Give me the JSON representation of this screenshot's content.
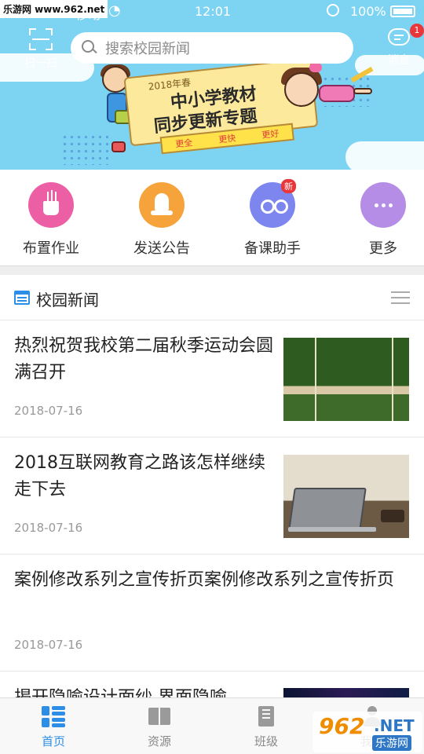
{
  "watermark": "乐游网 www.962.net",
  "status_bar": {
    "carrier": "移动",
    "time": "12:01",
    "battery": "100%"
  },
  "header": {
    "scan_label": "扫一扫",
    "search_placeholder": "搜索校园新闻",
    "messages_label": "消息",
    "messages_badge": "1"
  },
  "banner": {
    "year_tag": "2018年春",
    "title_line1": "中小学教材",
    "title_line2": "同步更新专题",
    "tags": [
      "更全",
      "更快",
      "更好"
    ]
  },
  "quick_actions": [
    {
      "label": "布置作业",
      "color": "#ec5fa4",
      "icon": "pencil-cup-icon"
    },
    {
      "label": "发送公告",
      "color": "#f7a33c",
      "icon": "bell-icon"
    },
    {
      "label": "备课助手",
      "color": "#7c86ee",
      "icon": "owl-icon",
      "badge": "新"
    },
    {
      "label": "更多",
      "color": "#b58de6",
      "icon": "more-dots-icon"
    }
  ],
  "news_section": {
    "title": "校园新闻"
  },
  "news": [
    {
      "title": "热烈祝贺我校第二届秋季运动会圆满召开",
      "date": "2018-07-16"
    },
    {
      "title": "2018互联网教育之路该怎样继续走下去",
      "date": "2018-07-16"
    },
    {
      "title": "案例修改系列之宣传折页案例修改系列之宣传折页",
      "date": "2018-07-16"
    },
    {
      "title": "揭开隐喻设计面纱 界面隐喻"
    }
  ],
  "tabbar": [
    {
      "label": "首页",
      "active": true
    },
    {
      "label": "资源"
    },
    {
      "label": "班级"
    },
    {
      "label": "我的"
    }
  ],
  "watermark_bottom": {
    "num": "962",
    "net": ".NET",
    "cn": "乐游网"
  },
  "colors": {
    "banner_bg": "#7dd3f2",
    "accent": "#2c8ee6",
    "badge": "#e8363a"
  }
}
